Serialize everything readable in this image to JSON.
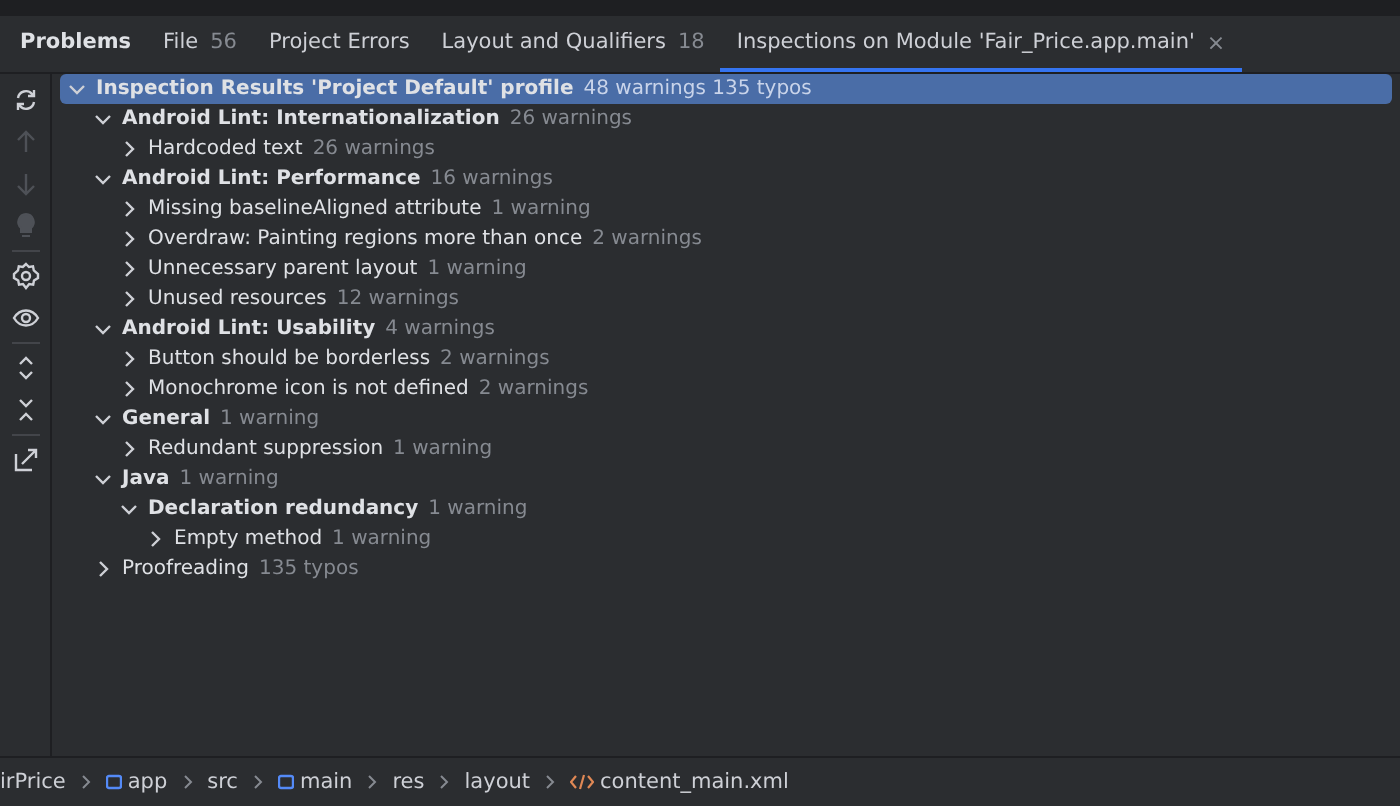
{
  "tabs": [
    {
      "label": "Problems",
      "selected": false,
      "kind": "title"
    },
    {
      "label": "File",
      "count": "56",
      "selected": false,
      "kind": "tab"
    },
    {
      "label": "Project Errors",
      "selected": false,
      "kind": "tab"
    },
    {
      "label": "Layout and Qualifiers",
      "count": "18",
      "selected": false,
      "kind": "tab"
    },
    {
      "label": "Inspections on Module 'Fair_Price.app.main'",
      "selected": true,
      "kind": "tab",
      "close": "×"
    }
  ],
  "tree": [
    {
      "label": "Inspection Results 'Project Default' profile",
      "count": "48 warnings 135 typos",
      "selected": true,
      "expanded": true,
      "children": [
        {
          "label": "Android Lint: Internationalization",
          "count": "26 warnings",
          "selected": false,
          "expanded": true,
          "children": [
            {
              "label": "Hardcoded text",
              "count": "26 warnings",
              "selected": false,
              "expanded": false
            }
          ]
        },
        {
          "label": "Android Lint: Performance",
          "count": "16 warnings",
          "selected": false,
          "expanded": true,
          "children": [
            {
              "label": "Missing baselineAligned attribute",
              "count": "1 warning",
              "selected": false,
              "expanded": false
            },
            {
              "label": "Overdraw: Painting regions more than once",
              "count": "2 warnings",
              "selected": false,
              "expanded": false
            },
            {
              "label": "Unnecessary parent layout",
              "count": "1 warning",
              "selected": false,
              "expanded": false
            },
            {
              "label": "Unused resources",
              "count": "12 warnings",
              "selected": false,
              "expanded": false
            }
          ]
        },
        {
          "label": "Android Lint: Usability",
          "count": "4 warnings",
          "selected": false,
          "expanded": true,
          "children": [
            {
              "label": "Button should be borderless",
              "count": "2 warnings",
              "selected": false,
              "expanded": false
            },
            {
              "label": "Monochrome icon is not defined",
              "count": "2 warnings",
              "selected": false,
              "expanded": false
            }
          ]
        },
        {
          "label": "General",
          "count": "1 warning",
          "selected": false,
          "expanded": true,
          "children": [
            {
              "label": "Redundant suppression",
              "count": "1 warning",
              "selected": false,
              "expanded": false
            }
          ]
        },
        {
          "label": "Java",
          "count": "1 warning",
          "selected": false,
          "expanded": true,
          "children": [
            {
              "label": "Declaration redundancy",
              "count": "1 warning",
              "selected": false,
              "expanded": true,
              "children": [
                {
                  "label": "Empty method",
                  "count": "1 warning",
                  "selected": false,
                  "expanded": false
                }
              ]
            }
          ]
        },
        {
          "label": "Proofreading",
          "count": "135 typos",
          "selected": false,
          "expanded": false
        }
      ]
    }
  ],
  "breadcrumb": [
    {
      "label": "irPrice",
      "kind": "text"
    },
    {
      "label": "app",
      "kind": "module"
    },
    {
      "label": "src",
      "kind": "text"
    },
    {
      "label": "main",
      "kind": "module"
    },
    {
      "label": "res",
      "kind": "text"
    },
    {
      "label": "layout",
      "kind": "text"
    },
    {
      "label": "content_main.xml",
      "kind": "xml"
    }
  ]
}
